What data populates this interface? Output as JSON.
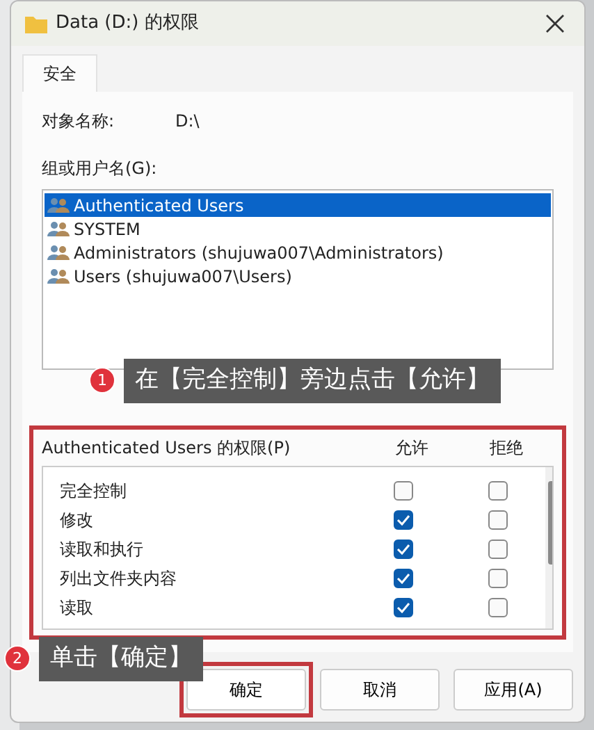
{
  "window": {
    "title": "Data (D:) 的权限"
  },
  "tabs": [
    {
      "label": "安全",
      "selected": true
    }
  ],
  "object_name": {
    "label": "对象名称:",
    "value": "D:\\"
  },
  "groups": {
    "label": "组或用户名(G):",
    "items": [
      {
        "name": "Authenticated Users",
        "selected": true
      },
      {
        "name": "SYSTEM",
        "selected": false
      },
      {
        "name": "Administrators (shujuwa007\\Administrators)",
        "selected": false
      },
      {
        "name": "Users (shujuwa007\\Users)",
        "selected": false
      }
    ]
  },
  "permissions": {
    "label": "Authenticated Users 的权限(P)",
    "allow_label": "允许",
    "deny_label": "拒绝",
    "rows": [
      {
        "name": "完全控制",
        "allow": false,
        "deny": false
      },
      {
        "name": "修改",
        "allow": true,
        "deny": false
      },
      {
        "name": "读取和执行",
        "allow": true,
        "deny": false
      },
      {
        "name": "列出文件夹内容",
        "allow": true,
        "deny": false
      },
      {
        "name": "读取",
        "allow": true,
        "deny": false
      }
    ]
  },
  "buttons": [
    {
      "label": "确定",
      "highlighted": true
    },
    {
      "label": "取消",
      "highlighted": false
    },
    {
      "label": "应用(A)",
      "highlighted": false
    }
  ],
  "callouts": [
    {
      "number": "1",
      "text": "在【完全控制】旁边点击【允许】"
    },
    {
      "number": "2",
      "text": "单击【确定】"
    }
  ]
}
